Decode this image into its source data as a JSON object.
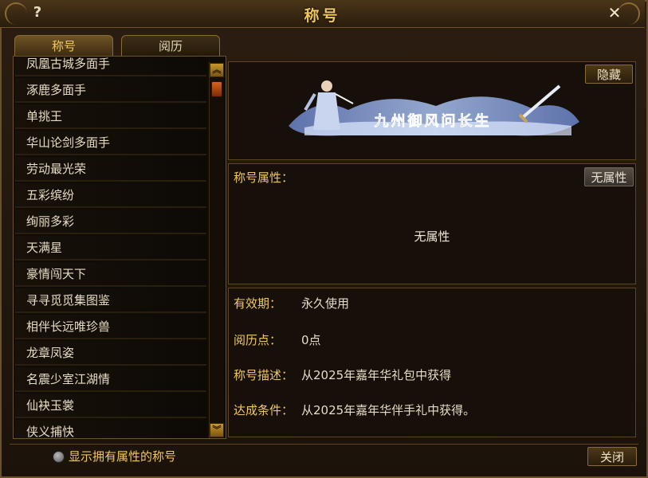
{
  "window": {
    "title": "称号"
  },
  "tabs": [
    {
      "label": "称号"
    },
    {
      "label": "阅历"
    }
  ],
  "title_list": [
    "凤凰古城多面手",
    "涿鹿多面手",
    "单挑王",
    "华山论剑多面手",
    "劳动最光荣",
    "五彩缤纷",
    "绚丽多彩",
    "天满星",
    "豪情闯天下",
    "寻寻觅觅集图鉴",
    "相伴长远唯珍兽",
    "龙章凤姿",
    "名震少室江湖情",
    "仙袂玉裳",
    "侠义捕快"
  ],
  "banner": {
    "text": "九州御风问长生",
    "hide_label": "隐藏"
  },
  "attributes": {
    "heading": "称号属性：",
    "button_label": "无属性",
    "content": "无属性"
  },
  "details": {
    "validity_label": "有效期：",
    "validity_value": "永久使用",
    "points_label": "阅历点：",
    "points_value": "0点",
    "desc_label": "称号描述：",
    "desc_value": "从2025年嘉年华礼包中获得",
    "cond_label": "达成条件：",
    "cond_value": "从2025年嘉年华伴手礼中获得。"
  },
  "footer": {
    "checkbox_label": "显示拥有属性的称号",
    "close_label": "关闭"
  },
  "icons": [
    "help-icon",
    "close-icon",
    "scroll-up-icon",
    "scroll-down-icon",
    "radio-icon"
  ],
  "colors": {
    "gold": "#f1c75a",
    "text": "#e6dcc5",
    "frame": "#6b5128"
  }
}
